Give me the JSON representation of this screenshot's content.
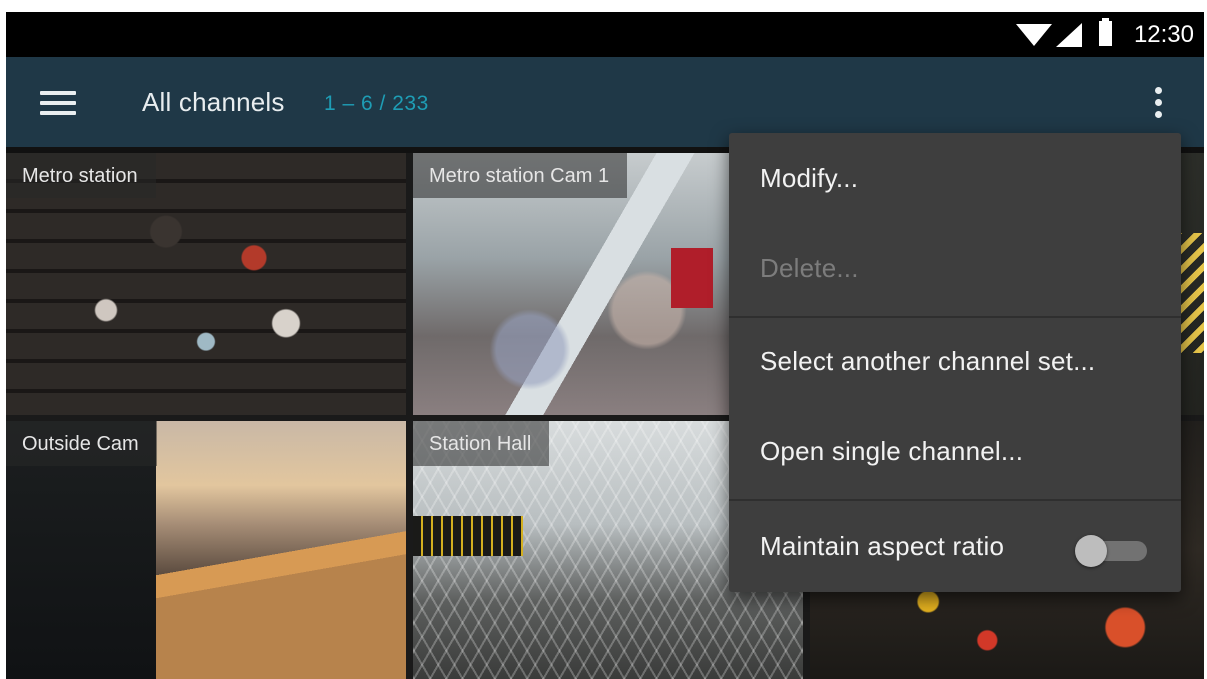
{
  "status_bar": {
    "time": "12:30",
    "icons": [
      "wifi-icon",
      "cell-signal-icon",
      "battery-icon"
    ]
  },
  "app_bar": {
    "title": "All channels",
    "range": "1 – 6 / 233",
    "range_color": "#1e9db5",
    "background": "#1f3847",
    "icons": [
      "hamburger-menu-icon",
      "overflow-menu-icon"
    ]
  },
  "channels": [
    {
      "label": "Metro station"
    },
    {
      "label": "Metro station Cam 1"
    },
    {
      "label": "Outside Cam"
    },
    {
      "label": "Station Hall"
    }
  ],
  "overflow_menu": {
    "items": [
      {
        "label": "Modify...",
        "enabled": true
      },
      {
        "label": "Delete...",
        "enabled": false
      },
      {
        "label": "Select another channel set...",
        "enabled": true
      },
      {
        "label": "Open single channel...",
        "enabled": true
      }
    ],
    "toggle": {
      "label": "Maintain aspect ratio",
      "checked": false
    }
  }
}
